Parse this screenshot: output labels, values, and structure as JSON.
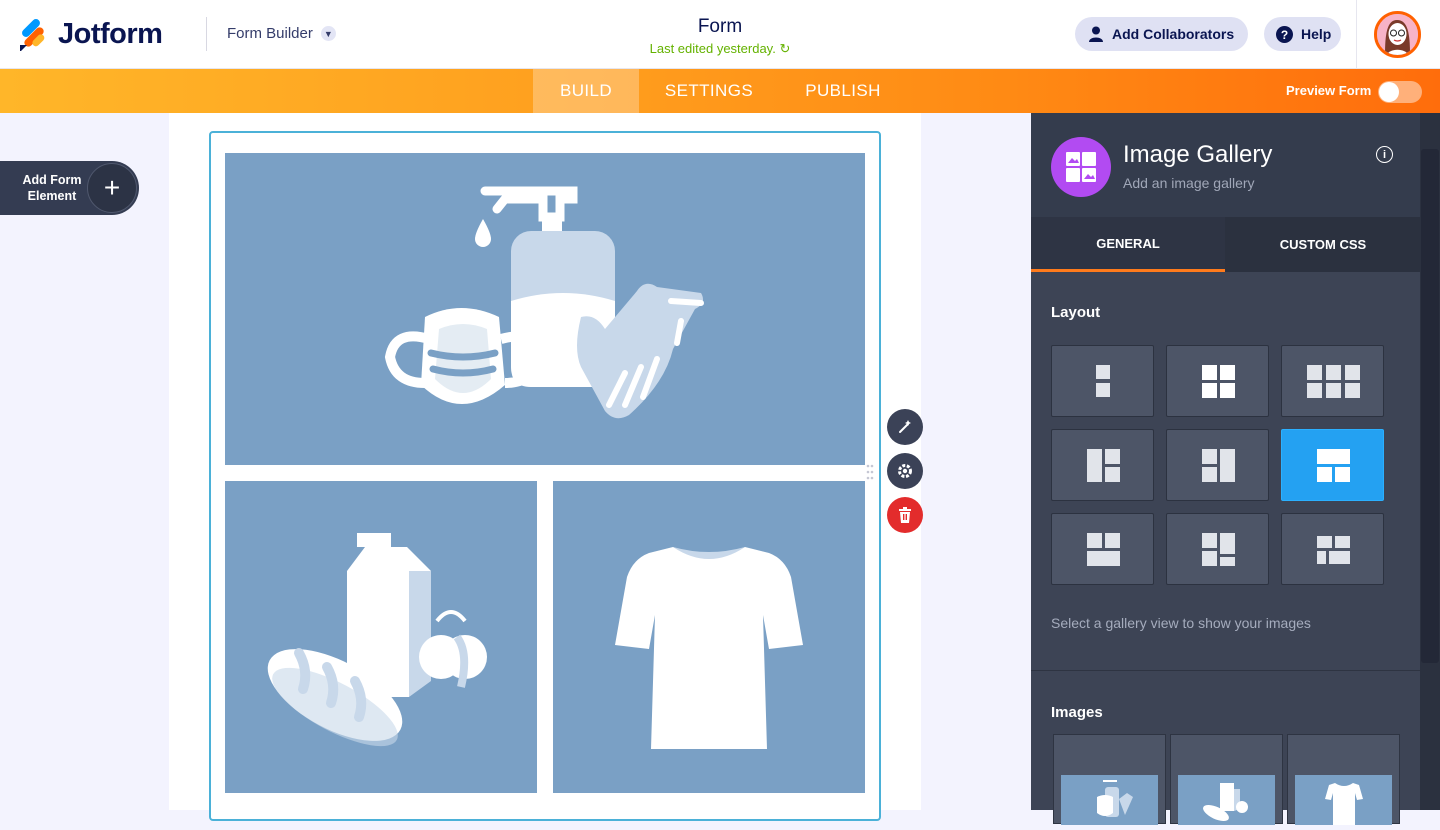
{
  "header": {
    "brand": "Jotform",
    "mode_label": "Form Builder",
    "form_title": "Form",
    "last_edited": "Last edited yesterday.",
    "add_collaborators": "Add Collaborators",
    "help": "Help"
  },
  "nav": {
    "tabs": [
      "BUILD",
      "SETTINGS",
      "PUBLISH"
    ],
    "active_tab": "BUILD",
    "preview_label": "Preview Form",
    "preview_on": false
  },
  "add_element": {
    "label": "Add Form Element"
  },
  "gallery_images": [
    "hygiene-supplies-image",
    "food-image",
    "tshirt-image"
  ],
  "panel": {
    "title": "Image Gallery",
    "subtitle": "Add an image gallery",
    "tabs": [
      "GENERAL",
      "CUSTOM CSS"
    ],
    "active_tab": "GENERAL",
    "layout_heading": "Layout",
    "layout_hint": "Select a gallery view to show your images",
    "layout_options": [
      "vertical",
      "grid-2x2",
      "grid-3x2",
      "big-left",
      "big-right",
      "big-top",
      "big-bottom",
      "mixed-1",
      "mixed-2"
    ],
    "selected_layout": "big-top",
    "images_heading": "Images"
  },
  "colors": {
    "brand_orange": "#ff6100",
    "accent_blue": "#24a1f2",
    "panel_bg": "#343c4d",
    "image_bg": "#7aa0c5",
    "delete_red": "#e32c2c"
  }
}
